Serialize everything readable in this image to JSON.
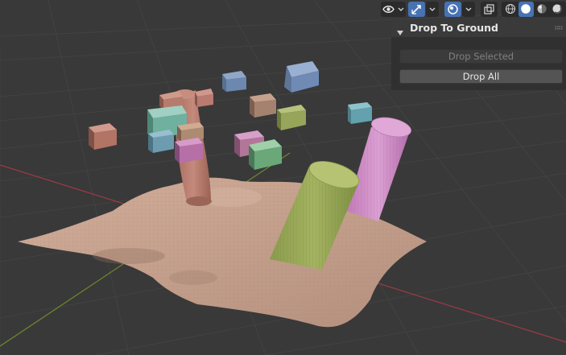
{
  "panel": {
    "title": "Drop To Ground",
    "drop_selected_label": "Drop Selected",
    "drop_all_label": "Drop All"
  },
  "header": {
    "icons": [
      "eye-icon",
      "chevron-down-icon",
      "gizmo-icon",
      "chevron-down-icon",
      "overlay-icon",
      "chevron-down-icon",
      "xray-icon",
      "shading-wireframe-icon",
      "shading-solid-icon",
      "shading-material-icon",
      "shading-rendered-icon"
    ],
    "active_shading": "solid"
  },
  "colors": {
    "background": "#393939",
    "grid": "#444444",
    "x_axis": "#9e3a45",
    "y_axis": "#6f8a2e",
    "accent": "#4772b3",
    "terrain": "#c5a08e",
    "panel": "#303030"
  }
}
